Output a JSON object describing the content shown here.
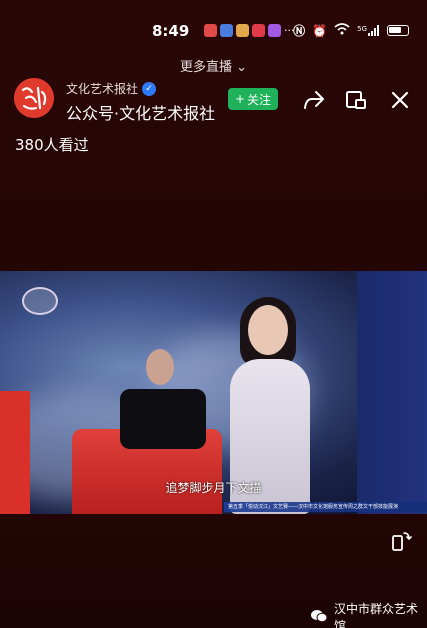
{
  "status_bar": {
    "time": "8:49",
    "signal_label": "5G"
  },
  "more_live": {
    "label": "更多直播",
    "chevron": "chevron-down-icon"
  },
  "header": {
    "account_name": "文化艺术报社",
    "account_title": "公众号·文化艺术报社",
    "follow_label": "关注",
    "logo_text": "文化艺术报"
  },
  "view_count": "380人看过",
  "video": {
    "subtitle": "追梦脚步月下文描",
    "banner_text": "第五季「悦动汉江」文艺赛——汉中市文化馆服务宣传周之群文干部技能展演"
  },
  "watermark": {
    "label": "汉中市群众艺术馆"
  },
  "colors": {
    "background": "#2a0707",
    "follow_button": "#1fb25a",
    "verified_badge": "#2e7bf5",
    "logo_red": "#e03a2d"
  }
}
